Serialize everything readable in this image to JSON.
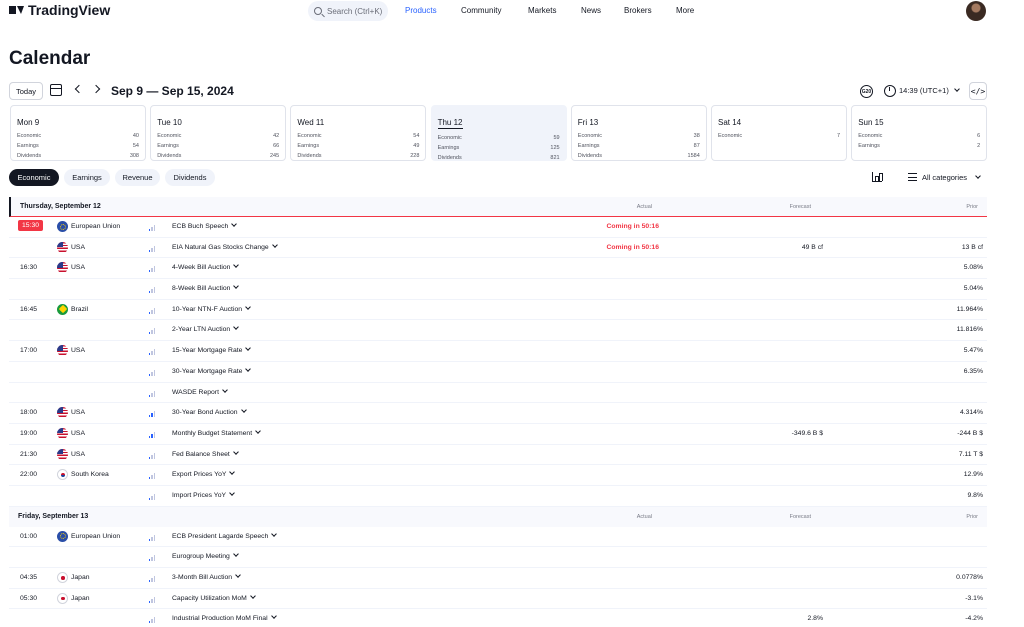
{
  "header": {
    "brand": "TradingView",
    "search_placeholder": "Search (Ctrl+K)",
    "nav": [
      "Products",
      "Community",
      "Markets",
      "News",
      "Brokers",
      "More"
    ],
    "active_nav": "Products"
  },
  "page_title": "Calendar",
  "toolbar": {
    "today_label": "Today",
    "week_range": "Sep 9 — Sep 15, 2024",
    "g20_label": "G20",
    "timezone": "14:39 (UTC+1)",
    "embed_label": "</>"
  },
  "days": [
    {
      "name": "Mon 9",
      "rows": [
        {
          "label": "Economic",
          "count": "40"
        },
        {
          "label": "Earnings",
          "count": "54"
        },
        {
          "label": "Dividends",
          "count": "308"
        }
      ]
    },
    {
      "name": "Tue 10",
      "rows": [
        {
          "label": "Economic",
          "count": "42"
        },
        {
          "label": "Earnings",
          "count": "66"
        },
        {
          "label": "Dividends",
          "count": "245"
        }
      ]
    },
    {
      "name": "Wed 11",
      "rows": [
        {
          "label": "Economic",
          "count": "54"
        },
        {
          "label": "Earnings",
          "count": "49"
        },
        {
          "label": "Dividends",
          "count": "228"
        }
      ]
    },
    {
      "name": "Thu 12",
      "active": true,
      "rows": [
        {
          "label": "Economic",
          "count": "59"
        },
        {
          "label": "Earnings",
          "count": "125"
        },
        {
          "label": "Dividends",
          "count": "821"
        }
      ]
    },
    {
      "name": "Fri 13",
      "rows": [
        {
          "label": "Economic",
          "count": "38"
        },
        {
          "label": "Earnings",
          "count": "87"
        },
        {
          "label": "Dividends",
          "count": "1584"
        }
      ]
    },
    {
      "name": "Sat 14",
      "rows": [
        {
          "label": "Economic",
          "count": "7"
        }
      ]
    },
    {
      "name": "Sun 15",
      "rows": [
        {
          "label": "Economic",
          "count": "6"
        },
        {
          "label": "Earnings",
          "count": "2"
        }
      ]
    }
  ],
  "filters": {
    "tabs": [
      "Economic",
      "Earnings",
      "Revenue",
      "Dividends"
    ],
    "active": "Economic",
    "categories_label": "All categories"
  },
  "columns": {
    "actual": "Actual",
    "forecast": "Forecast",
    "prior": "Prior"
  },
  "groups": [
    {
      "title": "Thursday, September 12",
      "events": [
        {
          "time": "15:30",
          "live": true,
          "flag": "eu",
          "country": "European Union",
          "importance": 1,
          "name": "ECB Buch Speech",
          "actual": "Coming in 50:16",
          "forecast": "",
          "prior": ""
        },
        {
          "time": "",
          "flag": "us",
          "country": "USA",
          "importance": 1,
          "name": "EIA Natural Gas Stocks Change",
          "actual": "Coming in 50:16",
          "forecast": "49 B cf",
          "prior": "13 B cf"
        },
        {
          "time": "16:30",
          "flag": "us",
          "country": "USA",
          "importance": 1,
          "name": "4-Week Bill Auction",
          "actual": "",
          "forecast": "",
          "prior": "5.08%"
        },
        {
          "time": "",
          "flag": "",
          "country": "",
          "importance": 1,
          "name": "8-Week Bill Auction",
          "actual": "",
          "forecast": "",
          "prior": "5.04%"
        },
        {
          "time": "16:45",
          "flag": "br",
          "country": "Brazil",
          "importance": 1,
          "name": "10-Year NTN-F Auction",
          "actual": "",
          "forecast": "",
          "prior": "11.964%"
        },
        {
          "time": "",
          "flag": "",
          "country": "",
          "importance": 1,
          "name": "2-Year LTN Auction",
          "actual": "",
          "forecast": "",
          "prior": "11.816%"
        },
        {
          "time": "17:00",
          "flag": "us",
          "country": "USA",
          "importance": 1,
          "name": "15-Year Mortgage Rate",
          "actual": "",
          "forecast": "",
          "prior": "5.47%"
        },
        {
          "time": "",
          "flag": "",
          "country": "",
          "importance": 1,
          "name": "30-Year Mortgage Rate",
          "actual": "",
          "forecast": "",
          "prior": "6.35%"
        },
        {
          "time": "",
          "flag": "",
          "country": "",
          "importance": 1,
          "name": "WASDE Report",
          "actual": "",
          "forecast": "",
          "prior": ""
        },
        {
          "time": "18:00",
          "flag": "us",
          "country": "USA",
          "importance": 2,
          "name": "30-Year Bond Auction",
          "actual": "",
          "forecast": "",
          "prior": "4.314%"
        },
        {
          "time": "19:00",
          "flag": "us",
          "country": "USA",
          "importance": 2,
          "name": "Monthly Budget Statement",
          "actual": "",
          "forecast": "-349.6 B $",
          "prior": "-244 B $"
        },
        {
          "time": "21:30",
          "flag": "us",
          "country": "USA",
          "importance": 1,
          "name": "Fed Balance Sheet",
          "actual": "",
          "forecast": "",
          "prior": "7.11 T $"
        },
        {
          "time": "22:00",
          "flag": "kr",
          "country": "South Korea",
          "importance": 1,
          "name": "Export Prices YoY",
          "actual": "",
          "forecast": "",
          "prior": "12.9%"
        },
        {
          "time": "",
          "flag": "",
          "country": "",
          "importance": 1,
          "name": "Import Prices YoY",
          "actual": "",
          "forecast": "",
          "prior": "9.8%"
        }
      ]
    },
    {
      "title": "Friday, September 13",
      "events": [
        {
          "time": "01:00",
          "flag": "eu",
          "country": "European Union",
          "importance": 1,
          "name": "ECB President Lagarde Speech",
          "actual": "",
          "forecast": "",
          "prior": ""
        },
        {
          "time": "",
          "flag": "",
          "country": "",
          "importance": 1,
          "name": "Eurogroup Meeting",
          "actual": "",
          "forecast": "",
          "prior": ""
        },
        {
          "time": "04:35",
          "flag": "jp",
          "country": "Japan",
          "importance": 1,
          "name": "3-Month Bill Auction",
          "actual": "",
          "forecast": "",
          "prior": "0.0778%"
        },
        {
          "time": "05:30",
          "flag": "jp",
          "country": "Japan",
          "importance": 1,
          "name": "Capacity Utilization MoM",
          "actual": "",
          "forecast": "",
          "prior": "-3.1%"
        },
        {
          "time": "",
          "flag": "",
          "country": "",
          "importance": 1,
          "name": "Industrial Production MoM Final",
          "actual": "",
          "forecast": "2.8%",
          "prior": "-4.2%"
        }
      ]
    }
  ],
  "colors": {
    "accent": "#2962ff",
    "live": "#f23645",
    "text": "#131722",
    "muted": "#787b86",
    "active_day_bg": "#f0f3fa"
  }
}
